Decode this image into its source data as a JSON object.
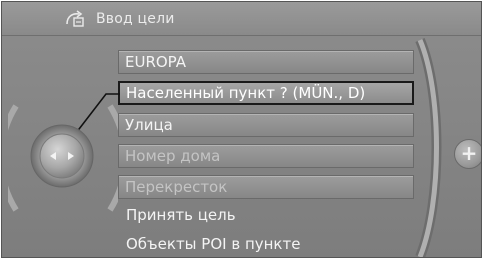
{
  "header": {
    "title": "Ввод цели",
    "icon": "navigation-destination-icon"
  },
  "menu": {
    "items": [
      {
        "label": "EUROPA",
        "state": "field"
      },
      {
        "label": "Населенный пункт ? (MÜN., D)",
        "state": "selected"
      },
      {
        "label": "Улица",
        "state": "field"
      },
      {
        "label": "Номер дома",
        "state": "disabled"
      },
      {
        "label": "Перекресток",
        "state": "disabled"
      },
      {
        "label": "Принять цель",
        "state": "plain"
      },
      {
        "label": "Объекты POI в пункте",
        "state": "plain"
      }
    ]
  },
  "controller": {
    "icon": "controller-left-right-icon"
  },
  "side_button": {
    "icon": "plus-icon",
    "label": "+"
  }
}
